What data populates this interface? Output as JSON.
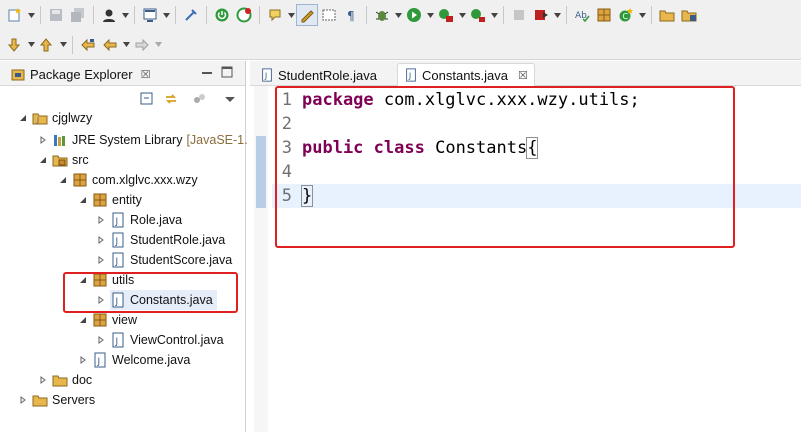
{
  "toolbar1": {
    "icons": [
      "new-wizard-icon",
      "save-icon",
      "save-all-icon",
      "perspective-icon",
      "console-icon",
      "pin-icon",
      "run-ext-icon",
      "refresh-badge-icon",
      "annotation-icon",
      "mark-occurrences-icon",
      "block-selection-icon",
      "show-whitespace-icon",
      "debug-icon",
      "run-icon",
      "coverage-icon",
      "external-tools-icon",
      "stop-icon",
      "run-last-icon",
      "spell-icon",
      "package-icon",
      "new-class-icon",
      "open-folder-icon",
      "open-type-icon"
    ]
  },
  "toolbar2": {
    "icons": [
      "next-annotation-icon",
      "prev-annotation-icon",
      "last-edit-icon",
      "back-icon",
      "forward-icon"
    ]
  },
  "package_explorer": {
    "title": "Package Explorer",
    "close_glyph": "☒"
  },
  "tree": {
    "project": "cjglwzy",
    "jre_label": "JRE System Library",
    "jre_decoration": "[JavaSE-1.",
    "src": "src",
    "root_package": "com.xlglvc.xxx.wzy",
    "entity": "entity",
    "role_java": "Role.java",
    "studentrole_java": "StudentRole.java",
    "studentscore_java": "StudentScore.java",
    "utils": "utils",
    "constants_java": "Constants.java",
    "view": "view",
    "viewcontrol_java": "ViewControl.java",
    "welcome_java": "Welcome.java",
    "doc": "doc",
    "servers": "Servers"
  },
  "editor": {
    "tabs": [
      {
        "label": "StudentRole.java"
      },
      {
        "label": "Constants.java",
        "close": "☒"
      }
    ],
    "line_numbers": [
      "1",
      "2",
      "3",
      "4",
      "5"
    ],
    "line1_kw": "package",
    "line1_rest": " com.xlglvc.xxx.wzy.utils;",
    "line3_kw1": "public",
    "line3_kw2": "class",
    "line3_name": " Constants",
    "open_brace": "{",
    "close_brace": "}"
  },
  "colors": {
    "keyword": "#7f0055",
    "highlight_box": "#e02020",
    "current_line": "#e8f2fe"
  }
}
